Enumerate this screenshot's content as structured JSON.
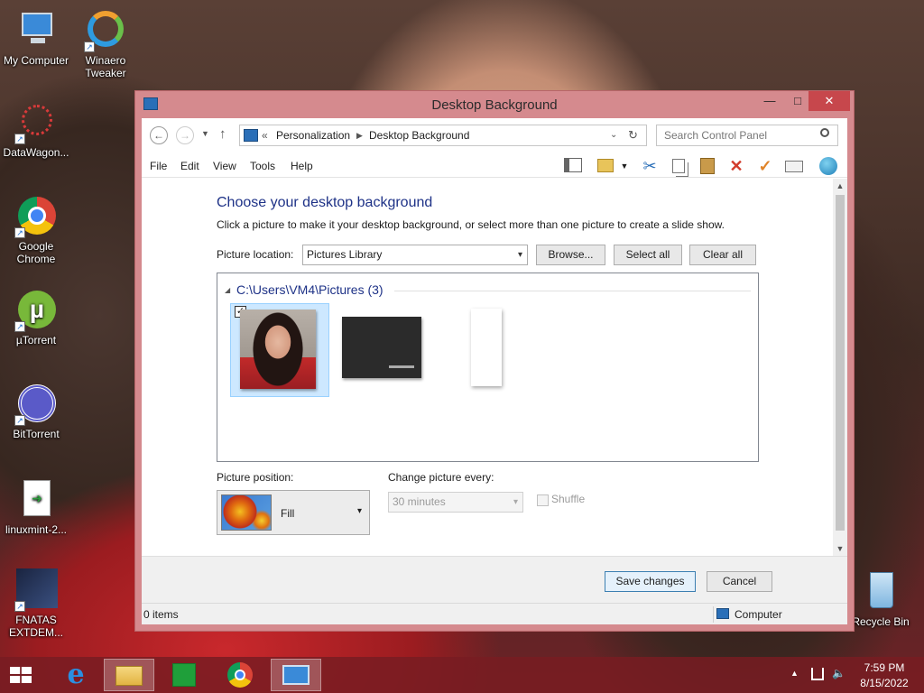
{
  "desktop": {
    "icons": [
      {
        "label": "My Computer"
      },
      {
        "label": "Winaero Tweaker"
      },
      {
        "label": "DataWagon..."
      },
      {
        "label": "Google Chrome"
      },
      {
        "label": "µTorrent"
      },
      {
        "label": "BitTorrent"
      },
      {
        "label": "linuxmint-2..."
      },
      {
        "label": "FNATAS EXTDEM..."
      },
      {
        "label": "Recycle Bin"
      }
    ]
  },
  "window": {
    "title": "Desktop Background",
    "controls": {
      "minimize": "—",
      "maximize": "□",
      "close": "✕"
    },
    "address": {
      "prefix": "«",
      "crumbs": [
        "Personalization",
        "Desktop Background"
      ]
    },
    "search_placeholder": "Search Control Panel",
    "menu": [
      "File",
      "Edit",
      "View",
      "Tools",
      "Help"
    ],
    "heading": "Choose your desktop background",
    "subtext": "Click a picture to make it your desktop background, or select more than one picture to create a slide show.",
    "picture_location_label": "Picture location:",
    "picture_location_value": "Pictures Library",
    "browse_label": "Browse...",
    "select_all_label": "Select all",
    "clear_all_label": "Clear all",
    "group_title": "C:\\Users\\VM4\\Pictures (3)",
    "check_mark": "✓",
    "picture_position_label": "Picture position:",
    "picture_position_value": "Fill",
    "change_every_label": "Change picture every:",
    "change_every_value": "30 minutes",
    "shuffle_label": "Shuffle",
    "save_label": "Save changes",
    "cancel_label": "Cancel",
    "status_items": "0 items",
    "status_location": "Computer"
  },
  "taskbar": {
    "time": "7:59 PM",
    "date": "8/15/2022"
  }
}
